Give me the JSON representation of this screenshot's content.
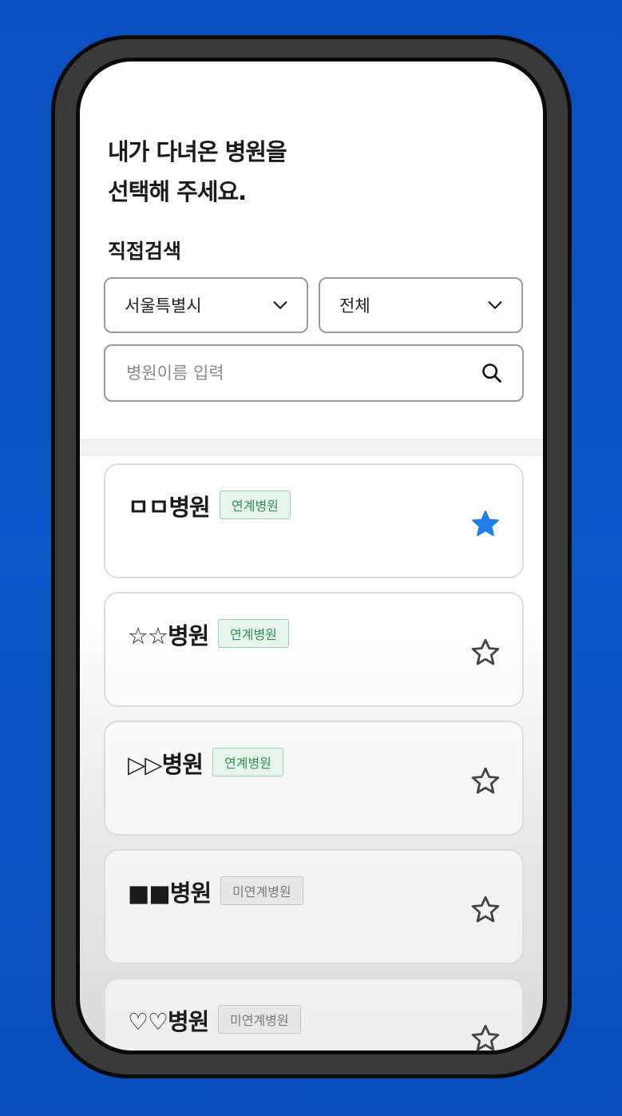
{
  "header": {
    "title_line1": "내가 다녀온 병원을",
    "title_line2": "선택해 주세요."
  },
  "search_section": {
    "label": "직접검색",
    "region_select": "서울특별시",
    "district_select": "전체",
    "search_placeholder": "병원이름 입력"
  },
  "hospitals": [
    {
      "name": "ㅁㅁ병원",
      "badge": "연계병원",
      "linked": true,
      "favorite": true
    },
    {
      "name": "☆☆병원",
      "badge": "연계병원",
      "linked": true,
      "favorite": false
    },
    {
      "name": "▷▷병원",
      "badge": "연계병원",
      "linked": true,
      "favorite": false
    },
    {
      "name": "■■병원",
      "badge": "미연계병원",
      "linked": false,
      "favorite": false
    },
    {
      "name": "♡♡병원",
      "badge": "미연계병원",
      "linked": false,
      "favorite": false
    }
  ],
  "colors": {
    "background": "#0a55c6",
    "favorite_star": "#1f7ee8",
    "linked_badge": "#2f8f56"
  }
}
